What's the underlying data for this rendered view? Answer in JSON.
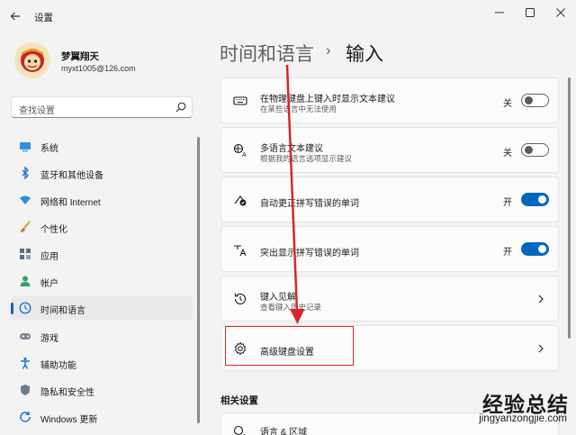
{
  "window": {
    "title": "设置",
    "back_icon": "back-arrow-icon",
    "controls": [
      "minimize-icon",
      "maximize-icon",
      "close-icon"
    ]
  },
  "account": {
    "name": "梦翼翔天",
    "email": "myxt1005@126.com"
  },
  "search": {
    "placeholder": "查找设置"
  },
  "sidebar": {
    "items": [
      {
        "label": "系统",
        "icon": "monitor-icon",
        "active": false
      },
      {
        "label": "蓝牙和其他设备",
        "icon": "bluetooth-icon",
        "active": false
      },
      {
        "label": "网络和 Internet",
        "icon": "wifi-icon",
        "active": false
      },
      {
        "label": "个性化",
        "icon": "brush-icon",
        "active": false
      },
      {
        "label": "应用",
        "icon": "apps-icon",
        "active": false
      },
      {
        "label": "帐户",
        "icon": "account-icon",
        "active": false
      },
      {
        "label": "时间和语言",
        "icon": "globe-clock-icon",
        "active": true
      },
      {
        "label": "游戏",
        "icon": "gamepad-icon",
        "active": false
      },
      {
        "label": "辅助功能",
        "icon": "accessibility-icon",
        "active": false
      },
      {
        "label": "隐私和安全性",
        "icon": "shield-icon",
        "active": false
      },
      {
        "label": "Windows 更新",
        "icon": "update-icon",
        "active": false
      }
    ]
  },
  "breadcrumb": {
    "parent": "时间和语言",
    "separator": "›",
    "current": "输入"
  },
  "settings": [
    {
      "title": "在物理键盘上键入时显示文本建议",
      "subtitle": "在某些语言中无法使用",
      "state_label": "关",
      "toggle": "off",
      "icon": "keyboard-icon"
    },
    {
      "title": "多语言文本建议",
      "subtitle": "根据我的语言选项显示建议",
      "state_label": "关",
      "toggle": "off",
      "icon": "language-icon"
    },
    {
      "title": "自动更正拼写错误的单词",
      "subtitle": "",
      "state_label": "开",
      "toggle": "on",
      "icon": "autocorrect-icon"
    },
    {
      "title": "突出显示拼写错误的单词",
      "subtitle": "",
      "state_label": "开",
      "toggle": "on",
      "icon": "spellcheck-icon"
    },
    {
      "title": "键入见解",
      "subtitle": "查看键入历史记录",
      "icon": "history-icon"
    },
    {
      "title": "高级键盘设置",
      "subtitle": "",
      "icon": "settings-gear-icon"
    }
  ],
  "related": {
    "heading": "相关设置",
    "items": [
      {
        "title": "语言 & 区域",
        "icon": "language-region-icon"
      }
    ]
  },
  "watermark": {
    "big": "经验总结",
    "small": "jingyanzongjie.com"
  },
  "colors": {
    "accent": "#0067c0",
    "annotation": "#d7262b"
  }
}
